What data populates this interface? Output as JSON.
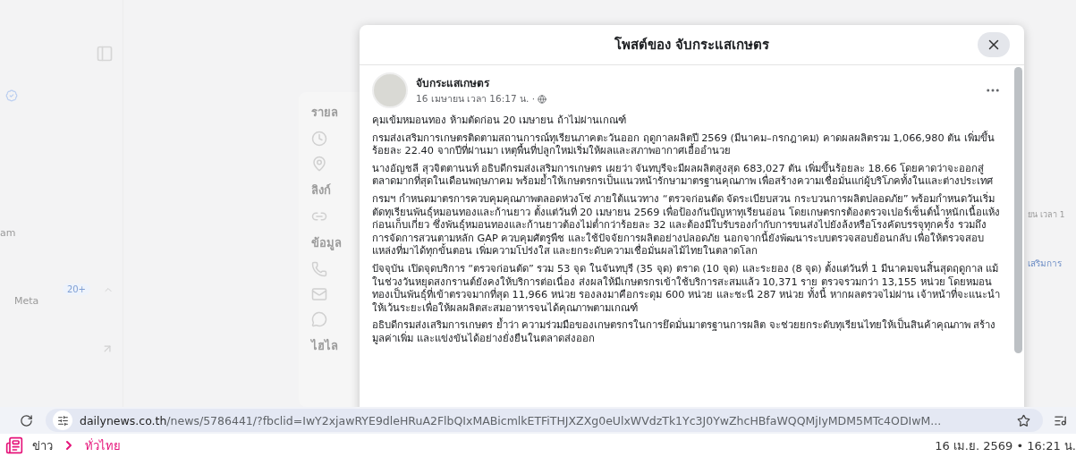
{
  "background": {
    "sidebar_texts": [
      "am",
      "Meta"
    ],
    "sidebar_badge": "20+",
    "about_sections": [
      "รายล",
      "ลิงก์",
      "ข้อมูล",
      "ไฮไล"
    ],
    "right_texts": [
      "ยน เวลา 1",
      "เสริมการ"
    ]
  },
  "dialog": {
    "title": "โพสต์ของ จับกระแสเกษตร",
    "post": {
      "author": "จับกระแสเกษตร",
      "time": "16 เมษายน เวลา 16:17 น. ·",
      "paragraphs": [
        "คุมเข้มหมอนทอง ห้ามตัดก่อน 20 เมษายน ถ้าไม่ผ่านเกณฑ์",
        "กรมส่งเสริมการเกษตรติดตามสถานการณ์ทุเรียนภาคตะวันออก ฤดูกาลผลิตปี 2569 (มีนาคม–กรกฎาคม) คาดผลผลิตรวม 1,066,980 ตัน เพิ่มขึ้นร้อยละ 22.40 จากปีที่ผ่านมา เหตุพื้นที่ปลูกใหม่เริ่มให้ผลและสภาพอากาศเอื้ออำนวย",
        "นางอัญชลี สุวจิตตานนท์ อธิบดีกรมส่งเสริมการเกษตร เผยว่า จันทบุรีจะมีผลผลิตสูงสุด 683,027 ตัน เพิ่มขึ้นร้อยละ 18.66 โดยคาดว่าจะออกสู่ตลาดมากที่สุดในเดือนพฤษภาคม พร้อมย้ำให้เกษตรกรเป็นแนวหน้ารักษามาตรฐานคุณภาพ เพื่อสร้างความเชื่อมั่นแก่ผู้บริโภคทั้งในและต่างประเทศ",
        "กรมฯ กำหนดมาตรการควบคุมคุณภาพตลอดห่วงโซ่ ภายใต้แนวทาง “ตรวจก่อนตัด จัดระเบียบสวน กระบวนการผลิตปลอดภัย” พร้อมกำหนดวันเริ่มตัดทุเรียนพันธุ์หมอนทองและก้านยาว ตั้งแต่วันที่ 20 เมษายน 2569 เพื่อป้องกันปัญหาทุเรียนอ่อน โดยเกษตรกรต้องตรวจเปอร์เซ็นต์น้ำหนักเนื้อแห้งก่อนเก็บเกี่ยว ซึ่งพันธุ์หมอนทองและก้านยาวต้องไม่ต่ำกว่าร้อยละ 32 และต้องมีใบรับรองกำกับการขนส่งไปยังล้งหรือโรงคัดบรรจุทุกครั้ง รวมถึงการจัดการสวนตามหลัก GAP ควบคุมศัตรูพืช และใช้ปัจจัยการผลิตอย่างปลอดภัย นอกจากนี้ยังพัฒนาระบบตรวจสอบย้อนกลับ เพื่อให้ตรวจสอบแหล่งที่มาได้ทุกขั้นตอน เพิ่มความโปร่งใส และยกระดับความเชื่อมั่นผลไม้ไทยในตลาดโลก",
        "ปัจจุบัน เปิดจุดบริการ “ตรวจก่อนตัด” รวม 53 จุด ในจันทบุรี (35 จุด) ตราด (10 จุด) และระยอง (8 จุด) ตั้งแต่วันที่ 1 มีนาคมจนสิ้นสุดฤดูกาล แม้ในช่วงวันหยุดสงกรานต์ยังคงให้บริการต่อเนื่อง ส่งผลให้มีเกษตรกรเข้าใช้บริการสะสมแล้ว 10,371 ราย ตรวจรวมกว่า 13,155 หน่วย โดยหมอนทองเป็นพันธุ์ที่เข้าตรวจมากที่สุด 11,966 หน่วย รองลงมาคือกระดุม 600 หน่วย และชะนี 287 หน่วย ทั้งนี้ หากผลตรวจไม่ผ่าน เจ้าหน้าที่จะแนะนำให้เว้นระยะเพื่อให้ผลผลิตสะสมอาหารจนได้คุณภาพตามเกณฑ์",
        "อธิบดีกรมส่งเสริมการเกษตร ย้ำว่า ความร่วมมือของเกษตรกรในการยึดมั่นมาตรฐานการผลิต จะช่วยยกระดับทุเรียนไทยให้เป็นสินค้าคุณภาพ สร้างมูลค่าเพิ่ม และแข่งขันได้อย่างยั่งยืนในตลาดส่งออก"
      ]
    }
  },
  "browser": {
    "url_host": "dailynews.co.th",
    "url_path": "/news/5786441/?fbclid=IwY2xjawRYE9dleHRuA2FlbQIxMABicmlkETFiTHJXZXg0eUlxWVdzTk1Yc3J0YwZhcHBfaWQQMjIyMDM5MTc4ODIwM..."
  },
  "news_bar": {
    "breadcrumbs": [
      {
        "label": "ข่าว",
        "selected": false
      },
      {
        "label": "ทั่วไทย",
        "selected": true
      }
    ],
    "date": "16 เม.ย. 2569 • 16:21 น."
  }
}
